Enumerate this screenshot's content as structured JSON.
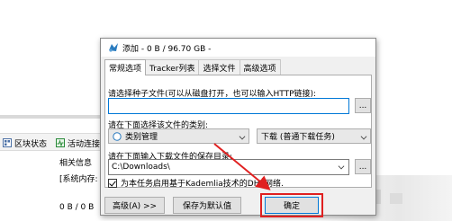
{
  "background": {
    "toolbar_items": [
      {
        "icon": "grid-icon",
        "label": "区块状态"
      },
      {
        "icon": "activity-icon",
        "label": "活动连接"
      }
    ],
    "related_info": "相关信息",
    "system_memory": "[系统内存:",
    "sizes": "0 B / 0 B",
    "accent_color": "#2a8a3a"
  },
  "dialog": {
    "title": "添加 - 0 B / 96.70 GB -",
    "tabs": [
      "常规选项",
      "Tracker列表",
      "选择文件",
      "高级选项"
    ],
    "seed_label": "请选择种子文件(可以从磁盘打开，也可以输入HTTP链接):",
    "seed_value": "",
    "browse_label": "...",
    "category_label": "请在下面选择该文件的类别:",
    "category_value": "类别管理",
    "download_mode_value": "下载 (普通下载任务)",
    "save_dir_label": "请在下面输入下载文件的保存目录:",
    "save_dir_value": "C:\\Downloads\\",
    "dht_checkbox_label": "为本任务启用基于Kademlia技术的DHT网络.",
    "dht_checked": true,
    "buttons": {
      "advanced": "高级(A) >>",
      "save_default": "保存为默认值",
      "ok": "确定"
    },
    "highlight_color": "#e02020",
    "focus_color": "#0078d7"
  }
}
